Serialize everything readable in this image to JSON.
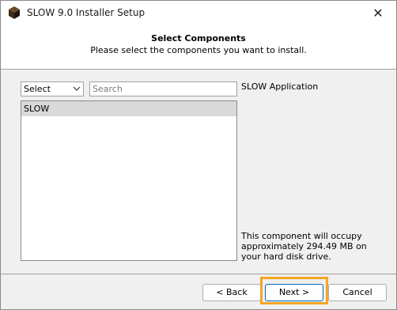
{
  "window": {
    "title": "SLOW 9.0 Installer Setup"
  },
  "header": {
    "title": "Select Components",
    "subtitle": "Please select the components you want to install."
  },
  "filter": {
    "selected": "Select",
    "search_placeholder": "Search"
  },
  "components": [
    {
      "label": "SLOW",
      "selected": true
    }
  ],
  "info": {
    "title": "SLOW Application",
    "description": "This component will occupy approximately 294.49 MB on your hard disk drive."
  },
  "buttons": {
    "back": "< Back",
    "next": "Next >",
    "cancel": "Cancel"
  },
  "colors": {
    "highlight": "#f5a623",
    "selection": "#d9d9d9"
  }
}
